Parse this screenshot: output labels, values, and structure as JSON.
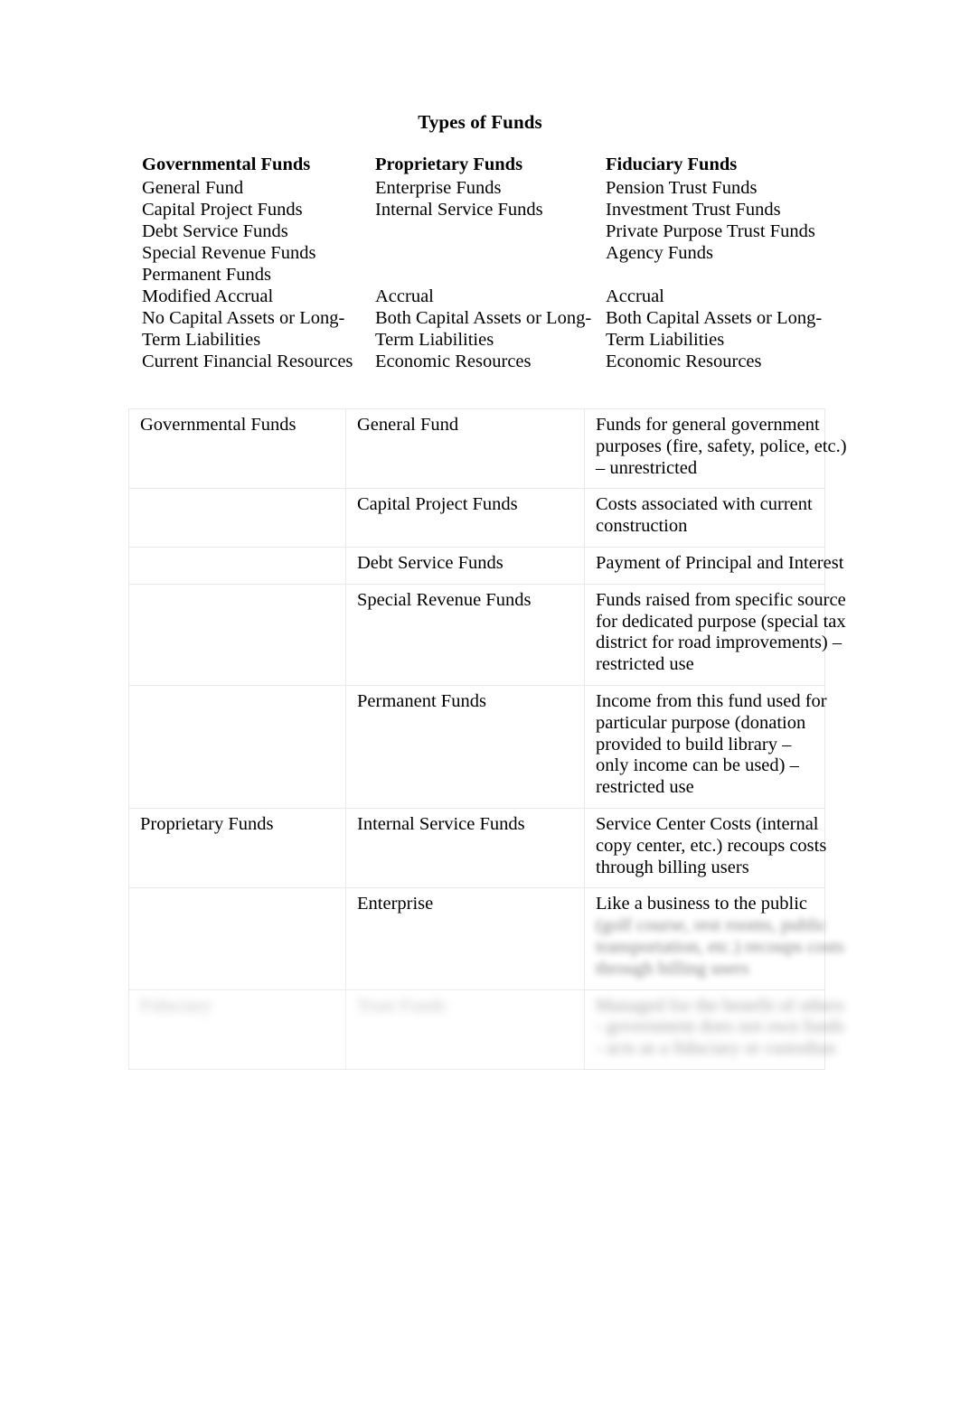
{
  "document": {
    "title": "Types of Funds"
  },
  "summary": {
    "columns": [
      {
        "heading": "Governmental Funds",
        "fund_types": [
          "General Fund",
          "Capital Project Funds",
          "Debt Service Funds",
          "Special Revenue Funds",
          "Permanent Funds"
        ],
        "basis_of_accounting": "Modified Accrual",
        "asset_liability_note": "No Capital Assets or Long-Term Liabilities",
        "measurement_focus": "Current Financial Resources"
      },
      {
        "heading": "Proprietary Funds",
        "fund_types": [
          "Enterprise Funds",
          "Internal Service Funds"
        ],
        "basis_of_accounting": "Accrual",
        "asset_liability_note": "Both Capital Assets or Long-Term Liabilities",
        "measurement_focus": "Economic Resources"
      },
      {
        "heading": "Fiduciary Funds",
        "fund_types": [
          "Pension Trust Funds",
          "Investment Trust Funds",
          "Private Purpose Trust Funds",
          "Agency Funds"
        ],
        "basis_of_accounting": "Accrual",
        "asset_liability_note": "Both Capital Assets or Long-Term Liabilities",
        "measurement_focus": "Economic Resources"
      }
    ]
  },
  "fund_table": {
    "rows": [
      {
        "category": "Governmental Funds",
        "fund": "General Fund",
        "description": "Funds for general government purposes (fire, safety, police, etc.) – unrestricted"
      },
      {
        "category": "",
        "fund": "Capital Project Funds",
        "description": "Costs associated with current construction"
      },
      {
        "category": "",
        "fund": "Debt Service Funds",
        "description": "Payment of Principal and Interest"
      },
      {
        "category": "",
        "fund": "Special Revenue Funds",
        "description": "Funds raised from specific source for dedicated purpose (special tax district for road improvements) – restricted use"
      },
      {
        "category": "",
        "fund": "Permanent Funds",
        "description": "Income from this fund used for particular purpose (donation provided to build library –\nonly income can be used) – restricted use"
      },
      {
        "category": "Proprietary Funds",
        "fund": "Internal Service Funds",
        "description": "Service Center Costs (internal copy center, etc.) recoups costs through billing users"
      },
      {
        "category": "",
        "fund": "Enterprise",
        "description": "Like a business to the public"
      },
      {
        "category": "",
        "fund": "",
        "description": "(golf course, rest rooms, public transportation, etc.) recoups costs through billing users",
        "obscured": true
      },
      {
        "category": "Fiduciary",
        "fund": "Trust Funds",
        "description": "Managed for the benefit of others - government does not own funds - acts as a fiduciary or custodian",
        "obscured": true
      }
    ]
  },
  "colors": {
    "page_background": "#ffffff",
    "text": "#000000",
    "table_border": "#e9e9e9"
  }
}
